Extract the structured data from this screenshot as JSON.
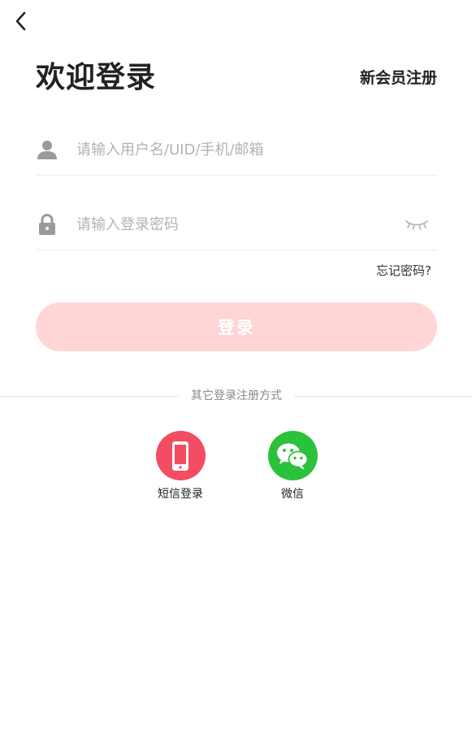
{
  "header": {
    "back_icon": "chevron-left-icon",
    "title": "欢迎登录",
    "register_label": "新会员注册"
  },
  "form": {
    "username": {
      "icon": "user-icon",
      "value": "",
      "placeholder": "请输入用户名/UID/手机/邮箱"
    },
    "password": {
      "icon": "lock-icon",
      "value": "",
      "placeholder": "请输入登录密码",
      "toggle_icon": "eye-closed-icon"
    },
    "forgot_label": "忘记密码?",
    "submit_label": "登录"
  },
  "alt_login": {
    "divider_label": "其它登录注册方式",
    "methods": [
      {
        "label": "短信登录",
        "icon": "phone-icon",
        "color": "#f24d62"
      },
      {
        "label": "微信",
        "icon": "wechat-icon",
        "color": "#2cc13c"
      }
    ]
  },
  "colors": {
    "accent": "#ffd5d6",
    "placeholder": "#b3b3b3",
    "icon_gray": "#9a9a9a"
  }
}
